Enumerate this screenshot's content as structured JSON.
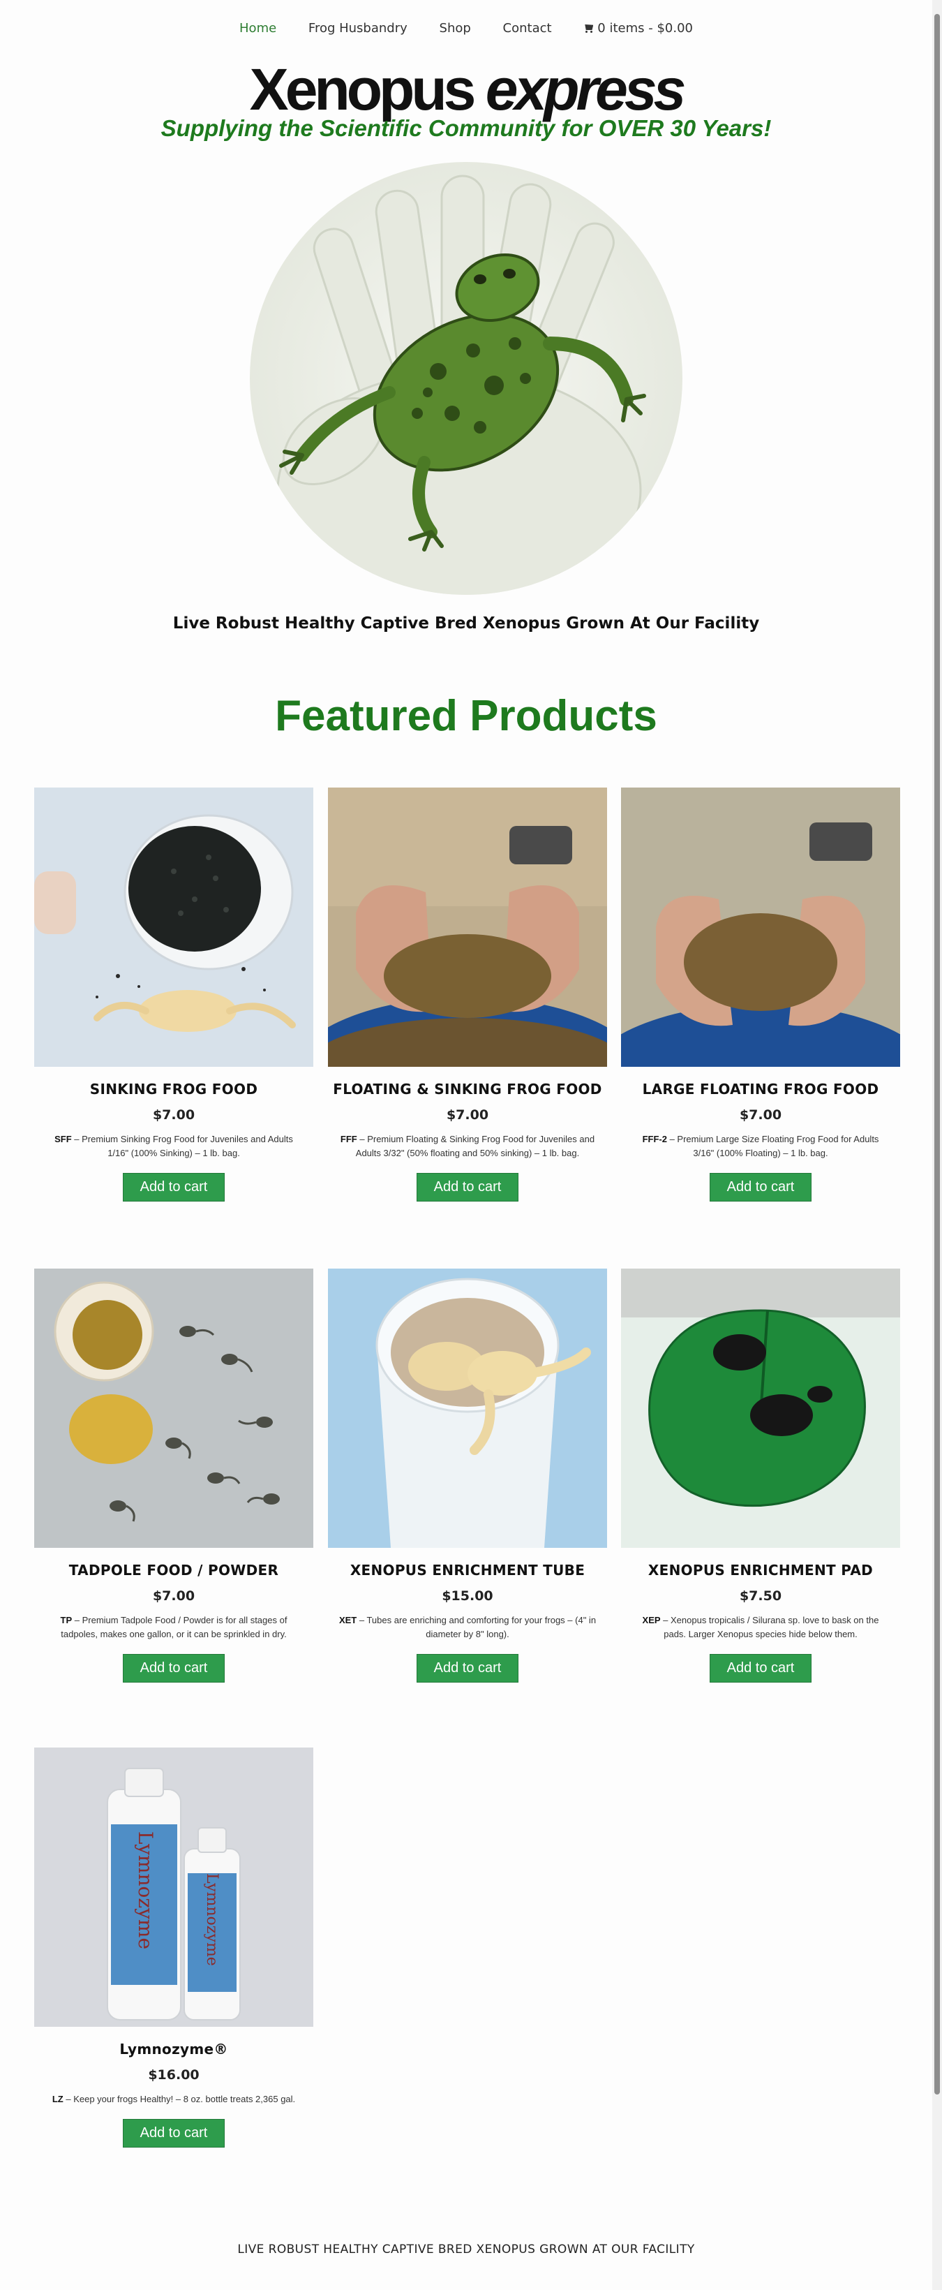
{
  "nav": {
    "items": [
      "Home",
      "Frog Husbandry",
      "Shop",
      "Contact"
    ],
    "active": "Home",
    "cart_label": "0 items - $0.00"
  },
  "header": {
    "logo_part1": "Xenopus",
    "logo_part2": "express",
    "tagline": "Supplying the Scientific Community for OVER 30 Years!",
    "hero_caption": "Live Robust Healthy Captive Bred Xenopus Grown At Our Facility"
  },
  "featured": {
    "title": "Featured Products"
  },
  "products": [
    {
      "title": "Sinking Frog Food",
      "price": "$7.00",
      "code": "SFF",
      "desc": " – Premium Sinking Frog Food for Juveniles and Adults 1/16\" (100% Sinking) – 1 lb. bag.",
      "button": "Add to cart"
    },
    {
      "title": "Floating & Sinking Frog Food",
      "price": "$7.00",
      "code": "FFF",
      "desc": " – Premium Floating & Sinking Frog Food for Juveniles and Adults 3/32\" (50% floating and 50% sinking) – 1 lb. bag.",
      "button": "Add to cart"
    },
    {
      "title": "Large Floating Frog Food",
      "price": "$7.00",
      "code": "FFF-2",
      "desc": " – Premium Large Size Floating Frog Food for Adults 3/16\" (100% Floating) – 1 lb. bag.",
      "button": "Add to cart"
    },
    {
      "title": "Tadpole Food / Powder",
      "price": "$7.00",
      "code": "TP",
      "desc": " –  Premium Tadpole Food / Powder is for all stages of tadpoles, makes one gallon, or it can be sprinkled in dry.",
      "button": "Add to cart"
    },
    {
      "title": "Xenopus Enrichment Tube",
      "price": "$15.00",
      "code": "XET",
      "desc": " – Tubes are enriching and comforting for your frogs – (4\" in diameter by 8\" long).",
      "button": "Add to cart"
    },
    {
      "title": "Xenopus Enrichment Pad",
      "price": "$7.50",
      "code": "XEP",
      "desc": " – Xenopus tropicalis / Silurana sp. love to bask on the pads. Larger Xenopus species hide below them.",
      "button": "Add to cart"
    },
    {
      "title": "Lymnozyme®",
      "price": "$16.00",
      "code": "LZ",
      "desc": " – Keep your frogs Healthy! – 8 oz. bottle treats 2,365 gal.",
      "button": "Add to cart"
    }
  ],
  "bottle_label": "Lymnozyme",
  "footer": {
    "text": "LIVE ROBUST HEALTHY CAPTIVE BRED XENOPUS GROWN AT OUR FACILITY"
  }
}
